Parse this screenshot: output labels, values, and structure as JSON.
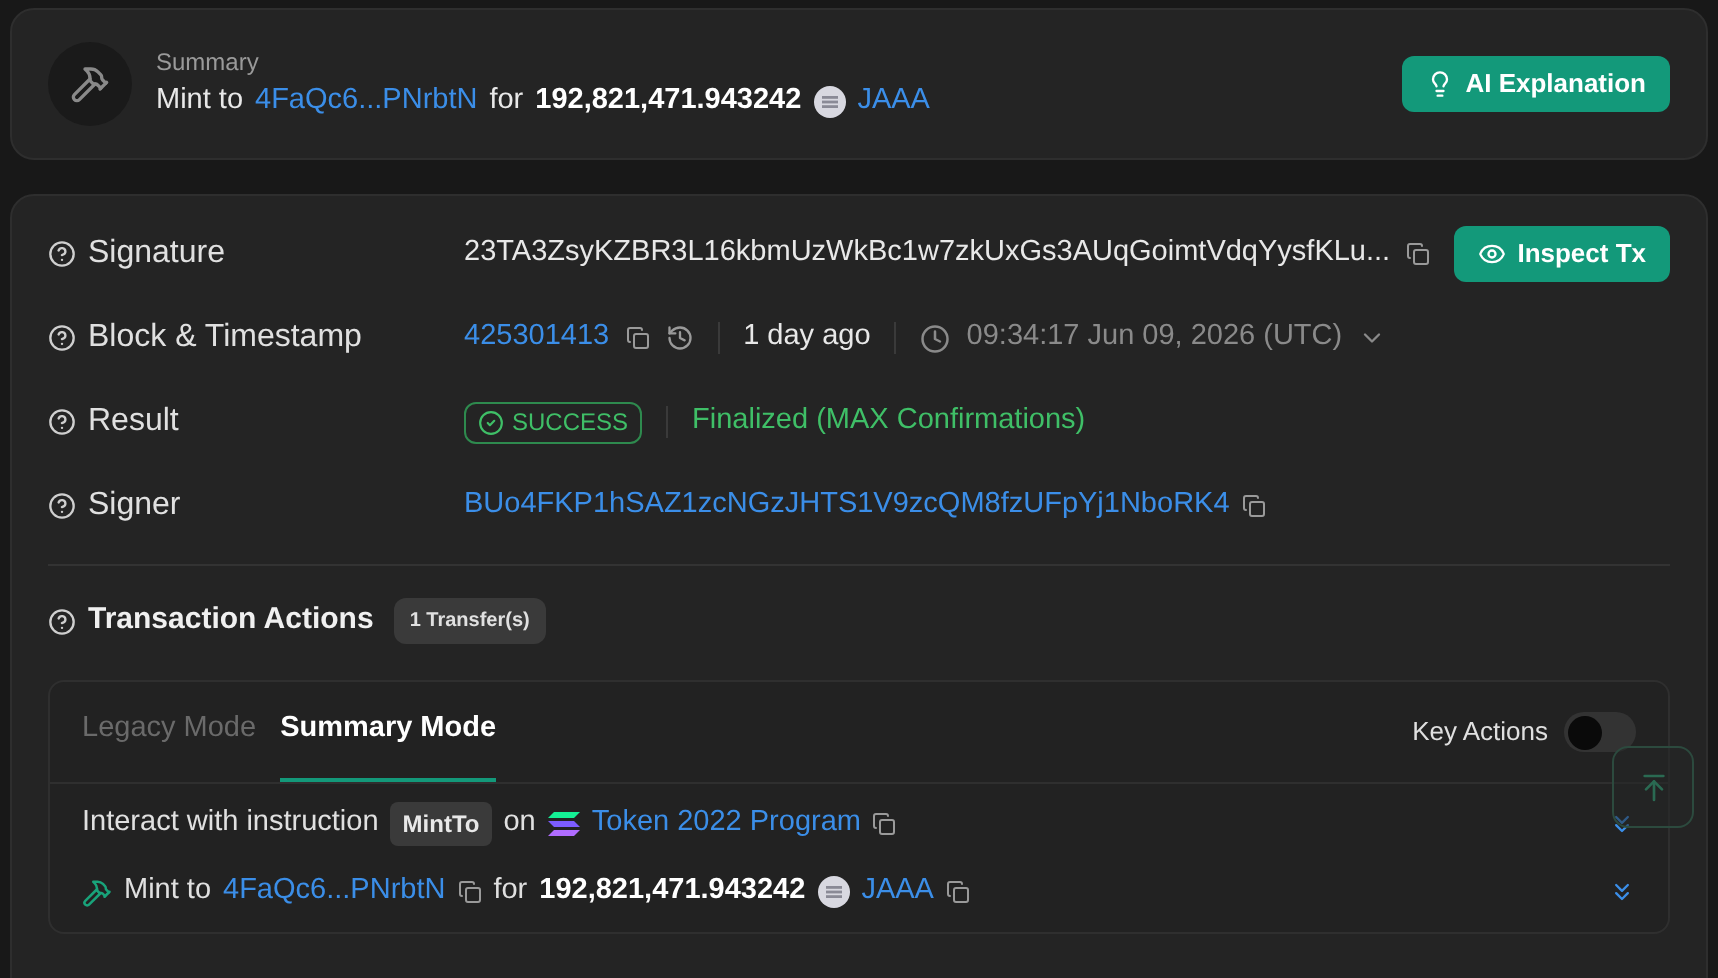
{
  "summary": {
    "label": "Summary",
    "prefix": "Mint to",
    "address": "4FaQc6...PNrbtN",
    "connector": "for",
    "amount": "192,821,471.943242",
    "token": "JAAA",
    "button": "AI Explanation"
  },
  "details": [
    {
      "kind": "signature",
      "label": "Signature",
      "value": "23TA3ZsyKZBR3L16kbmUzWkBc1w7zkUxGs3AUqGoimtVdqYysfKLu...",
      "button": "Inspect Tx"
    },
    {
      "kind": "block",
      "label": "Block & Timestamp",
      "block": "425301413",
      "ago": "1 day ago",
      "timestamp": "09:34:17 Jun 09, 2026 (UTC)"
    },
    {
      "kind": "result",
      "label": "Result",
      "status": "SUCCESS",
      "confirmation": "Finalized (MAX Confirmations)"
    },
    {
      "kind": "signer",
      "label": "Signer",
      "value": "BUo4FKP1hSAZ1zcNGzJHTS1V9zcQM8fzUFpYj1NboRK4"
    }
  ],
  "actions": {
    "title": "Transaction Actions",
    "badge": "1 Transfer(s)",
    "tabs": [
      {
        "label": "Legacy Mode",
        "selected": false
      },
      {
        "label": "Summary Mode",
        "selected": true
      }
    ],
    "key_actions": {
      "label": "Key Actions",
      "on": false
    },
    "rows": [
      {
        "kind": "instruction",
        "prefix": "Interact with instruction",
        "instruction": "MintTo",
        "connector": "on",
        "program": "Token 2022 Program"
      },
      {
        "kind": "mint",
        "prefix": "Mint to",
        "address": "4FaQc6...PNrbtN",
        "connector": "for",
        "amount": "192,821,471.943242",
        "token": "JAAA"
      }
    ]
  }
}
